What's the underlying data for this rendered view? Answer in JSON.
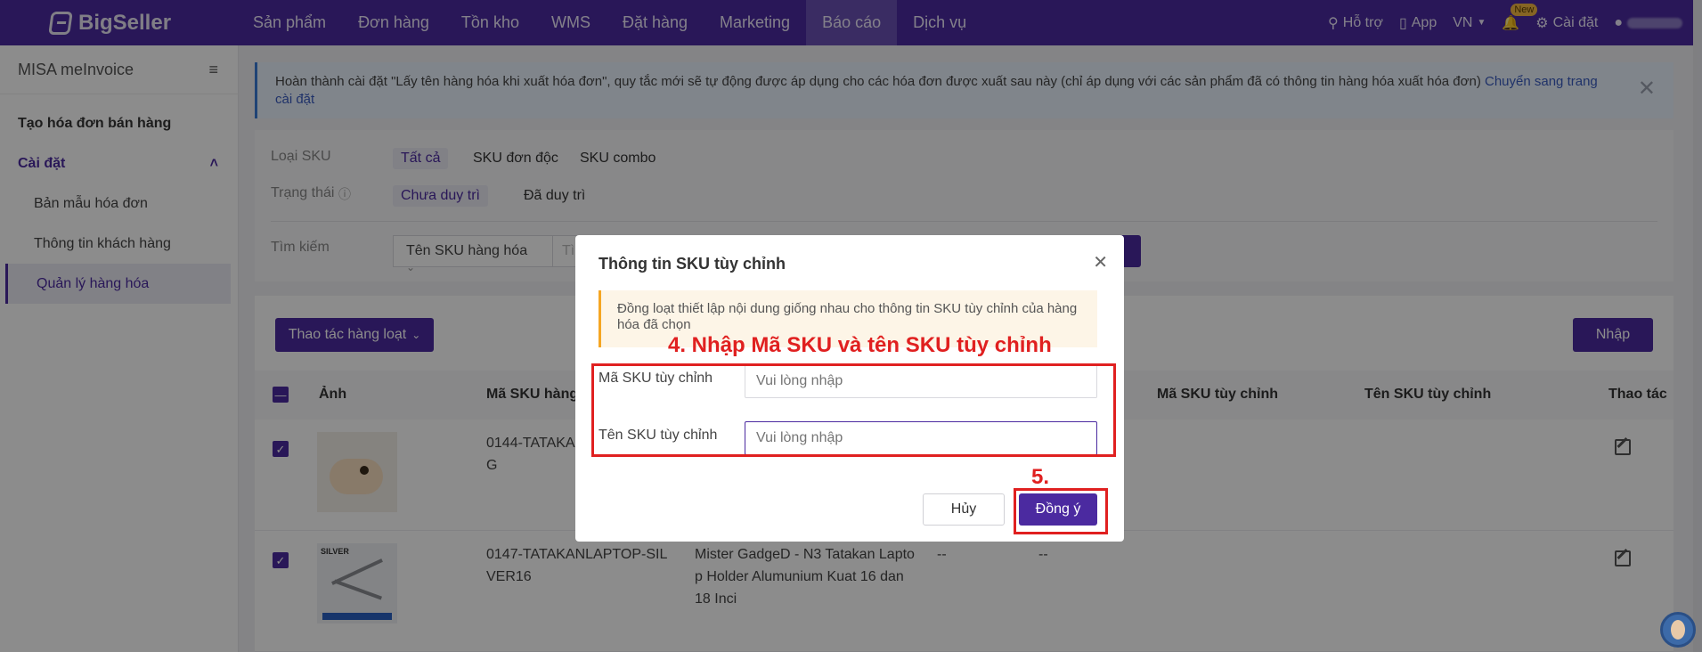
{
  "app": {
    "brand": "BigSeller"
  },
  "nav": {
    "items": [
      "Sản phẩm",
      "Đơn hàng",
      "Tồn kho",
      "WMS",
      "Đặt hàng",
      "Marketing",
      "Báo cáo",
      "Dịch vụ"
    ],
    "active": "Báo cáo",
    "support": "Hỗ trợ",
    "app_link": "App",
    "lang": "VN",
    "new_badge": "New",
    "settings": "Cài đặt"
  },
  "sidebar": {
    "title": "MISA meInvoice",
    "items": [
      "Tạo hóa đơn bán hàng",
      "Cài đặt",
      "Bản mẫu hóa đơn",
      "Thông tin khách hàng",
      "Quản lý hàng hóa"
    ]
  },
  "banner": {
    "text": "Hoàn thành cài đặt \"Lấy tên hàng hóa khi xuất hóa đơn\", quy tắc mới sẽ tự động được áp dụng cho các hóa đơn được xuất sau này (chỉ áp dụng với các sản phẩm đã có thông tin hàng hóa xuất hóa đơn)",
    "link": "Chuyển sang trang cài đặt"
  },
  "filters": {
    "sku_type_label": "Loại SKU",
    "sku_type_options": [
      "Tất cả",
      "SKU đơn độc",
      "SKU combo"
    ],
    "status_label": "Trạng thái",
    "status_options": [
      "Chưa duy trì",
      "Đã duy trì"
    ],
    "search_label": "Tìm kiếm",
    "search_field": "Tên SKU hàng hóa",
    "search_placeholder_peek": "Tì"
  },
  "table": {
    "bulk_button": "Thao tác hàng loạt",
    "import_button": "Nhập",
    "headers": [
      "Ảnh",
      "Mã SKU hàng h",
      "Mã SKU tùy chỉnh",
      "Tên SKU tùy chỉnh",
      "Thao tác"
    ],
    "rows": [
      {
        "sku_line1": "0144-TATAKAN",
        "sku_line2": "G",
        "name_line1": "",
        "name_line2": "",
        "name_line3": "",
        "c1": "",
        "c2": "",
        "thumb_label": ""
      },
      {
        "sku_line1": "0147-TATAKANLAPTOP-SIL",
        "sku_line2": "VER16",
        "name_line1": "Mister GadgeD - N3 Tatakan Lapto",
        "name_line2": "p Holder Alumunium Kuat 16 dan",
        "name_line3": "18 Inci",
        "c1": "--",
        "c2": "--",
        "thumb_label": "SILVER"
      }
    ]
  },
  "modal": {
    "title": "Thông tin SKU tùy chỉnh",
    "warning": "Đồng loạt thiết lập nội dung giống nhau cho thông tin SKU tùy chỉnh của hàng hóa đã chọn",
    "field1_label": "Mã SKU tùy chỉnh",
    "field1_placeholder": "Vui lòng nhập",
    "field2_label": "Tên SKU tùy chỉnh",
    "field2_placeholder": "Vui lòng nhập",
    "cancel": "Hủy",
    "ok": "Đồng ý"
  },
  "annotations": {
    "step4": "4. Nhập Mã SKU và tên SKU tùy chỉnh",
    "step5": "5.",
    "color": "#e02020"
  },
  "colors": {
    "brand": "#4b2aa0",
    "accent_link": "#3a5bbf",
    "warning_bar": "#f5a623"
  }
}
